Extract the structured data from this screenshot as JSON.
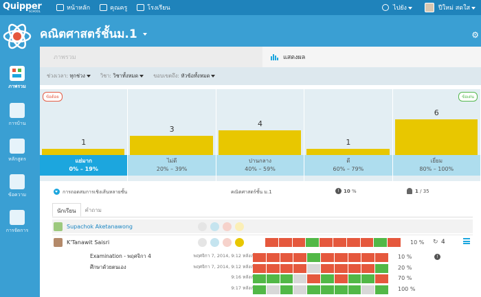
{
  "topbar": {
    "logo": "Quipper",
    "logo_sub": "SCHOOL",
    "nav": [
      {
        "label": "หน้าหลัก",
        "icon": "home-icon"
      },
      {
        "label": "คุณครู",
        "icon": "teacher-icon"
      },
      {
        "label": "โรงเรียน",
        "icon": "school-icon"
      }
    ],
    "language": "ไปยัง",
    "user": "ปีใหม่ สดใส"
  },
  "sidebar": {
    "items": [
      {
        "label": "ภาพรวม",
        "icon": "overview-icon",
        "active": true
      },
      {
        "label": "การบ้าน",
        "icon": "homework-icon",
        "active": false
      },
      {
        "label": "หลักสูตร",
        "icon": "curriculum-icon",
        "active": false
      },
      {
        "label": "ข้อความ",
        "icon": "message-icon",
        "active": false
      },
      {
        "label": "การจัดการ",
        "icon": "management-icon",
        "active": false
      }
    ]
  },
  "header": {
    "title": "คณิตศาสตร์ชั้นม.1"
  },
  "tabs": {
    "overview": "ภาพรวม",
    "results": "แสดงผล"
  },
  "filters": {
    "period_label": "ช่วงเวลา:",
    "period_value": "ทุกช่วง",
    "subject_label": "วิชา:",
    "subject_value": "วิชาทั้งหมด",
    "scope_label": "ขอบเขตถึง:",
    "scope_value": "หัวข้อทั้งหมด"
  },
  "chart_data": {
    "type": "bar",
    "categories": [
      "แย่มาก",
      "ไม่ดี",
      "ปานกลาง",
      "ดี",
      "เยี่ยม"
    ],
    "ranges": [
      "0% – 19%",
      "20% – 39%",
      "40% – 59%",
      "60% – 79%",
      "80% – 100%"
    ],
    "values": [
      1,
      3,
      4,
      1,
      6
    ],
    "selected_index": 0,
    "weak_tag": "ข้อด้อย",
    "strong_tag": "ข้อเด่น",
    "ylim": [
      0,
      6
    ]
  },
  "topic": {
    "name": "การถอดสมการเชิงเส้นหลายชั้น",
    "course": "คณิตศาสตร์ชั้น ม.1",
    "avg_percent": "10",
    "avg_unit": "%",
    "students_done": "1",
    "students_total": "/ 35"
  },
  "subtabs": {
    "students": "นักเรียน",
    "questions": "คำถาม"
  },
  "students": [
    {
      "name": "Supachok Aketanawong"
    },
    {
      "name": "K'Tanawit Saisri",
      "percent": "10",
      "unit": "%",
      "attempts": "4"
    }
  ],
  "attempts": [
    {
      "label": "Examination - พฤศจิกา 4",
      "when": "พฤศจิกา 7, 2014, 9:12 หลังเที่ยง",
      "percent": "10",
      "unit": "%"
    },
    {
      "label": "ศึกษาด้วยตนเอง",
      "when": "พฤศจิกา 7, 2014, 9:12 หลังเที่ยง",
      "percent": "20",
      "unit": "%"
    },
    {
      "label": "",
      "when": "9:16 หลังเที่ยง",
      "percent": "70",
      "unit": "%"
    },
    {
      "label": "",
      "when": "9:17 หลังเที่ยง",
      "percent": "100",
      "unit": "%"
    }
  ],
  "answer_grid": {
    "summary": [
      "R",
      "R",
      "R",
      "G",
      "R",
      "R",
      "R",
      "R",
      "G",
      "R"
    ],
    "rows": [
      [
        "R",
        "R",
        "R",
        "R",
        "G",
        "R",
        "R",
        "R",
        "R",
        "R"
      ],
      [
        "R",
        "R",
        "R",
        "R",
        "E",
        "R",
        "R",
        "R",
        "R",
        "G"
      ],
      [
        "G",
        "G",
        "G",
        "E",
        "R",
        "G",
        "R",
        "G",
        "G",
        "R"
      ],
      [
        "G",
        "E",
        "G",
        "E",
        "G",
        "G",
        "G",
        "G",
        "E",
        "G"
      ]
    ]
  },
  "colors": {
    "accent": "#1ca6de",
    "bar": "#e8c700",
    "wrong": "#e5583d",
    "correct": "#52b847"
  }
}
